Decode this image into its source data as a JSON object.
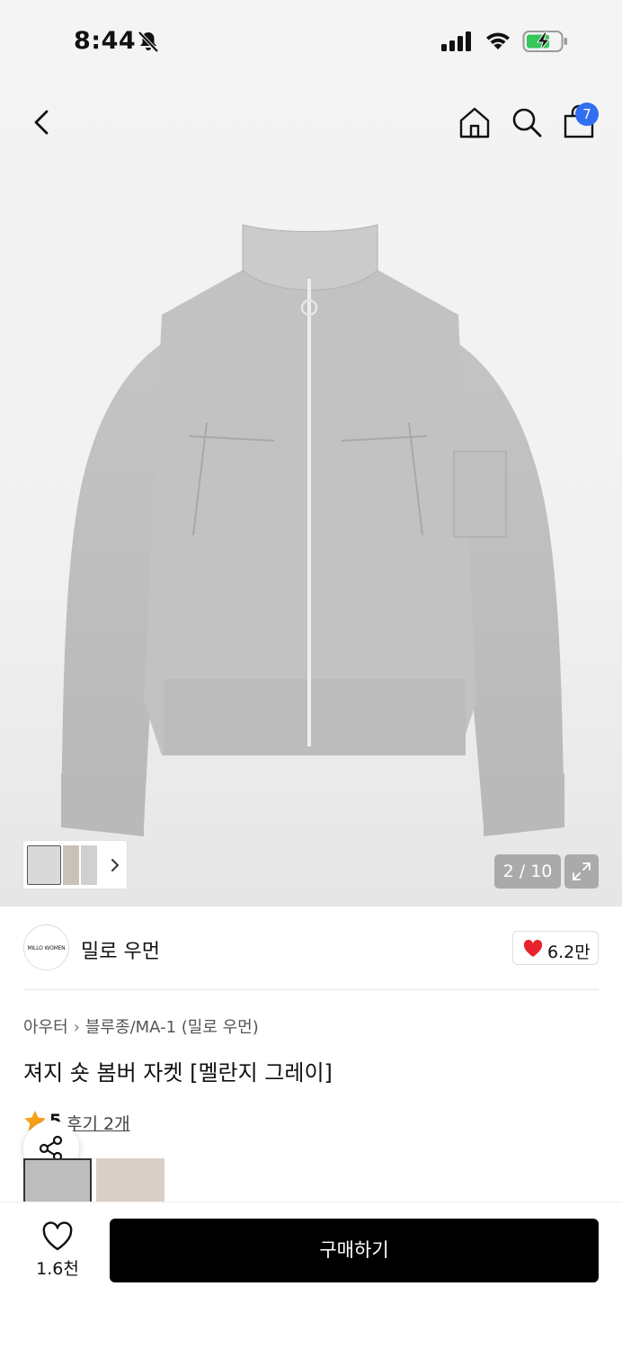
{
  "status_bar": {
    "time": "8:44",
    "icons": [
      "bell-muted-icon",
      "signal-icon",
      "wifi-icon",
      "battery-charging-icon"
    ]
  },
  "top_nav": {
    "cart_count": "7",
    "icons": [
      "back-icon",
      "home-icon",
      "search-icon",
      "shopping-bag-icon"
    ]
  },
  "gallery": {
    "counter": "2 / 10"
  },
  "brand": {
    "logo_text": "MILLO WOMEN",
    "name": "밀로 우먼",
    "likes": "6.2만"
  },
  "breadcrumb": {
    "category": "아우터",
    "subcategory": "블루종/MA-1 (밀로 우먼)"
  },
  "product": {
    "title": "져지 숏 봄버 자켓 [멜란지 그레이]",
    "rating": "5",
    "reviews_label": "후기 2개"
  },
  "bottom_bar": {
    "wish_count": "1.6천",
    "buy_label": "구매하기"
  },
  "colors": {
    "accent_blue": "#2f6ff0",
    "heart_red": "#e8232e",
    "star_orange": "#f7a21b",
    "button_black": "#000000"
  }
}
